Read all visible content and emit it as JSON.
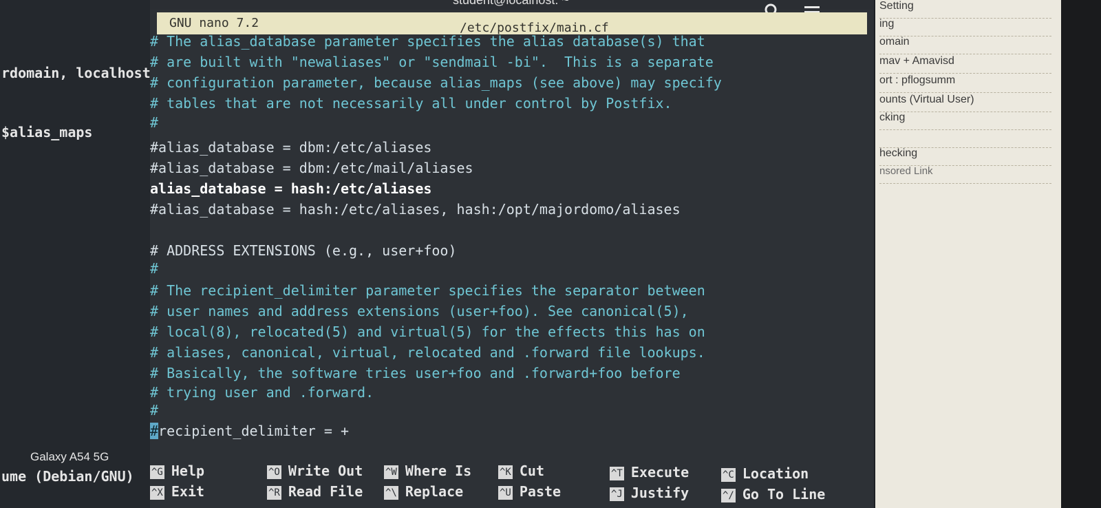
{
  "background_terminal": {
    "line1": "rdomain, localhost",
    "line2": "$alias_maps",
    "device_label": "Galaxy A54 5G",
    "line3": "ume (Debian/GNU)"
  },
  "window": {
    "title": "student@localhost: ~",
    "search_icon": "search-icon",
    "menu_icon": "hamburger-menu-icon",
    "close_icon": "close-icon"
  },
  "nano": {
    "version": "GNU nano 7.2",
    "filename": "/etc/postfix/main.cf",
    "lines": [
      "# The alias_database parameter specifies the alias database(s) that",
      "# are built with \"newaliases\" or \"sendmail -bi\".  This is a separate",
      "# configuration parameter, because alias_maps (see above) may specify",
      "# tables that are not necessarily all under control by Postfix.",
      "#",
      "#alias_database = dbm:/etc/aliases",
      "#alias_database = dbm:/etc/mail/aliases",
      "alias_database = hash:/etc/aliases",
      "#alias_database = hash:/etc/aliases, hash:/opt/majordomo/aliases",
      "",
      "# ADDRESS EXTENSIONS (e.g., user+foo)",
      "#",
      "# The recipient_delimiter parameter specifies the separator between",
      "# user names and address extensions (user+foo). See canonical(5),",
      "# local(8), relocated(5) and virtual(5) for the effects this has on",
      "# aliases, canonical, virtual, relocated and .forward file lookups.",
      "# Basically, the software tries user+foo and .forward+foo before",
      "# trying user and .forward.",
      "#",
      "recipient_delimiter = +"
    ],
    "cursor_char": "#",
    "shortcuts": [
      {
        "key": "^G",
        "label": "Help"
      },
      {
        "key": "^O",
        "label": "Write Out"
      },
      {
        "key": "^W",
        "label": "Where Is"
      },
      {
        "key": "^K",
        "label": "Cut"
      },
      {
        "key": "^T",
        "label": "Execute"
      },
      {
        "key": "^C",
        "label": "Location"
      },
      {
        "key": "^X",
        "label": "Exit"
      },
      {
        "key": "^R",
        "label": "Read File"
      },
      {
        "key": "^\\",
        "label": "Replace"
      },
      {
        "key": "^U",
        "label": "Paste"
      },
      {
        "key": "^J",
        "label": "Justify"
      },
      {
        "key": "^/",
        "label": "Go To Line"
      }
    ]
  },
  "right_panel": {
    "items": [
      "Setting",
      "ing",
      "omain",
      "mav + Amavisd",
      "ort : pflogsumm",
      "ounts (Virtual User)",
      "cking",
      "",
      "hecking",
      "nsored Link"
    ]
  },
  "colors": {
    "nano_header_bg": "#e9e5c3",
    "comment_text": "#6fc6d4",
    "cursor_bg": "#5fa9c8"
  }
}
